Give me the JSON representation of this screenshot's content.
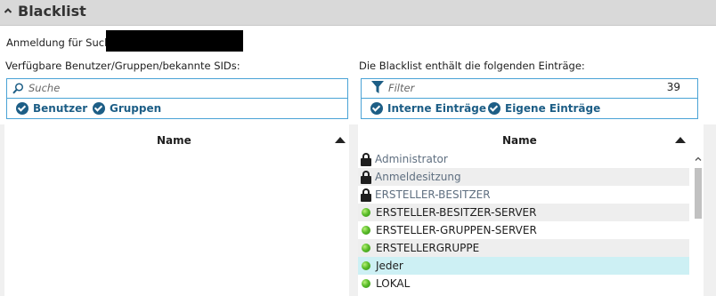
{
  "header": {
    "title": "Blacklist"
  },
  "login": {
    "label": "Anmeldung für Suche"
  },
  "left": {
    "section_label": "Verfügbare Benutzer/Gruppen/bekannte SIDs:",
    "search_placeholder": "Suche",
    "options": [
      "Benutzer",
      "Gruppen"
    ],
    "column": "Name"
  },
  "right": {
    "section_label": "Die Blacklist enthält die folgenden Einträge:",
    "filter_placeholder": "Filter",
    "count": "39",
    "options": [
      "Interne Einträge",
      "Eigene Einträge"
    ],
    "column": "Name",
    "rows": [
      {
        "label": "Administrator",
        "icon": "lock-icon"
      },
      {
        "label": "Anmeldesitzung",
        "icon": "lock-icon"
      },
      {
        "label": "ERSTELLER-BESITZER",
        "icon": "lock-icon"
      },
      {
        "label": "ERSTELLER-BESITZER-SERVER",
        "icon": "green-dot-icon"
      },
      {
        "label": "ERSTELLER-GRUPPEN-SERVER",
        "icon": "green-dot-icon"
      },
      {
        "label": "ERSTELLERGRUPPE",
        "icon": "green-dot-icon"
      },
      {
        "label": "Jeder",
        "icon": "green-dot-icon"
      },
      {
        "label": "LOKAL",
        "icon": "green-dot-icon"
      }
    ]
  },
  "colors": {
    "accent": "#1d5e86",
    "border": "#4aa3d6",
    "selected_row": "#cdf0f4"
  }
}
